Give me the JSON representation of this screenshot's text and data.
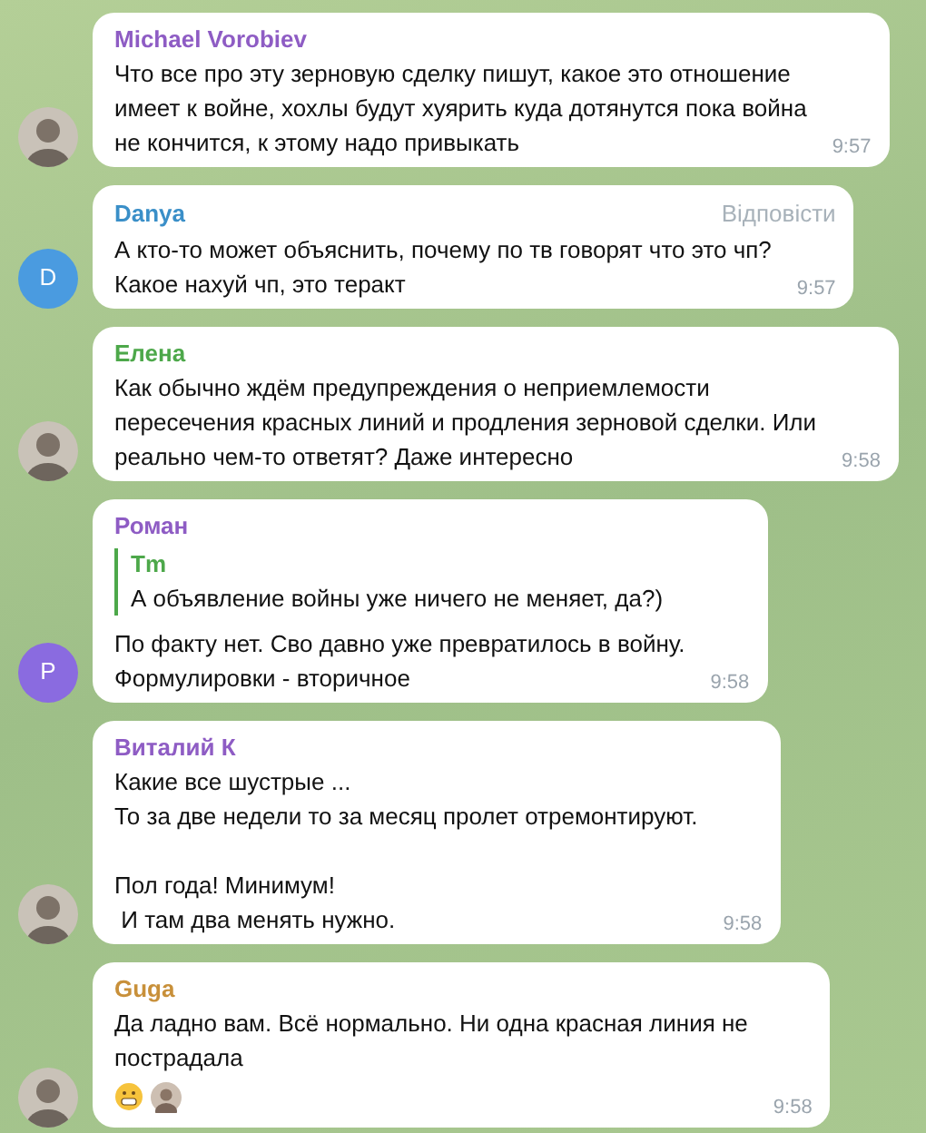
{
  "messages": [
    {
      "author": "Michael Vorobiev",
      "color": "#8e5cc4",
      "avatar": {
        "kind": "photo"
      },
      "text": "Что все про эту зерновую сделку пишут, какое это отношение\nимеет к войне, хохлы будут хуярить куда дотянутся пока война\nне кончится, к этому надо привыкать",
      "time": "9:57"
    },
    {
      "author": "Danya",
      "color": "#3a8fc8",
      "avatar": {
        "kind": "letter",
        "letter": "D",
        "color": "#4a9be0"
      },
      "reply_link": "Відповісти",
      "text": "А кто-то может объяснить, почему по тв говорят что это чп?\nКакое нахуй чп, это теракт",
      "time": "9:57"
    },
    {
      "author": "Елена",
      "color": "#4da84a",
      "avatar": {
        "kind": "photo"
      },
      "text": "Как обычно ждём предупреждения о неприемлемости\nпересечения красных линий и продления зерновой сделки. Или\nреально чем-то ответят? Даже интересно",
      "time": "9:58"
    },
    {
      "author": "Роман",
      "color": "#8e5cc4",
      "avatar": {
        "kind": "letter",
        "letter": "P",
        "color": "#8a6be0"
      },
      "quote": {
        "author": "Tm",
        "text": "А объявление войны уже ничего не меняет, да?)"
      },
      "text": "По факту нет. Сво давно уже превратилось в войну.\nФормулировки - вторичное",
      "time": "9:58"
    },
    {
      "author": "Виталий К",
      "color": "#8e5cc4",
      "avatar": {
        "kind": "photo"
      },
      "text": "Какие все шустрые ...\nТо за две недели то за месяц пролет отремонтируют.\n\nПол года! Минимум!\n И там два менять нужно.",
      "time": "9:58"
    },
    {
      "author": "Guga",
      "color": "#c8903a",
      "avatar": {
        "kind": "photo"
      },
      "text": "Да ладно вам. Всё нормально. Ни одна красная линия не\nпострадала",
      "reaction": {
        "kind": "grin"
      },
      "time": "9:58"
    }
  ]
}
